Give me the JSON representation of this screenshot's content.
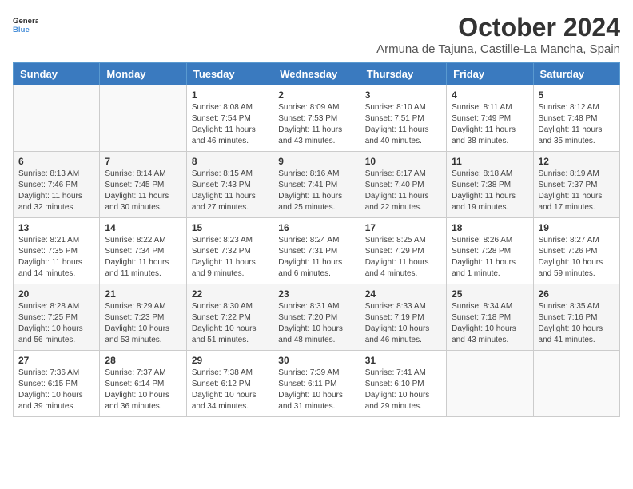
{
  "logo": {
    "line1": "General",
    "line2": "Blue"
  },
  "title": "October 2024",
  "location": "Armuna de Tajuna, Castille-La Mancha, Spain",
  "headers": [
    "Sunday",
    "Monday",
    "Tuesday",
    "Wednesday",
    "Thursday",
    "Friday",
    "Saturday"
  ],
  "weeks": [
    [
      {
        "day": "",
        "info": ""
      },
      {
        "day": "",
        "info": ""
      },
      {
        "day": "1",
        "info": "Sunrise: 8:08 AM\nSunset: 7:54 PM\nDaylight: 11 hours\nand 46 minutes."
      },
      {
        "day": "2",
        "info": "Sunrise: 8:09 AM\nSunset: 7:53 PM\nDaylight: 11 hours\nand 43 minutes."
      },
      {
        "day": "3",
        "info": "Sunrise: 8:10 AM\nSunset: 7:51 PM\nDaylight: 11 hours\nand 40 minutes."
      },
      {
        "day": "4",
        "info": "Sunrise: 8:11 AM\nSunset: 7:49 PM\nDaylight: 11 hours\nand 38 minutes."
      },
      {
        "day": "5",
        "info": "Sunrise: 8:12 AM\nSunset: 7:48 PM\nDaylight: 11 hours\nand 35 minutes."
      }
    ],
    [
      {
        "day": "6",
        "info": "Sunrise: 8:13 AM\nSunset: 7:46 PM\nDaylight: 11 hours\nand 32 minutes."
      },
      {
        "day": "7",
        "info": "Sunrise: 8:14 AM\nSunset: 7:45 PM\nDaylight: 11 hours\nand 30 minutes."
      },
      {
        "day": "8",
        "info": "Sunrise: 8:15 AM\nSunset: 7:43 PM\nDaylight: 11 hours\nand 27 minutes."
      },
      {
        "day": "9",
        "info": "Sunrise: 8:16 AM\nSunset: 7:41 PM\nDaylight: 11 hours\nand 25 minutes."
      },
      {
        "day": "10",
        "info": "Sunrise: 8:17 AM\nSunset: 7:40 PM\nDaylight: 11 hours\nand 22 minutes."
      },
      {
        "day": "11",
        "info": "Sunrise: 8:18 AM\nSunset: 7:38 PM\nDaylight: 11 hours\nand 19 minutes."
      },
      {
        "day": "12",
        "info": "Sunrise: 8:19 AM\nSunset: 7:37 PM\nDaylight: 11 hours\nand 17 minutes."
      }
    ],
    [
      {
        "day": "13",
        "info": "Sunrise: 8:21 AM\nSunset: 7:35 PM\nDaylight: 11 hours\nand 14 minutes."
      },
      {
        "day": "14",
        "info": "Sunrise: 8:22 AM\nSunset: 7:34 PM\nDaylight: 11 hours\nand 11 minutes."
      },
      {
        "day": "15",
        "info": "Sunrise: 8:23 AM\nSunset: 7:32 PM\nDaylight: 11 hours\nand 9 minutes."
      },
      {
        "day": "16",
        "info": "Sunrise: 8:24 AM\nSunset: 7:31 PM\nDaylight: 11 hours\nand 6 minutes."
      },
      {
        "day": "17",
        "info": "Sunrise: 8:25 AM\nSunset: 7:29 PM\nDaylight: 11 hours\nand 4 minutes."
      },
      {
        "day": "18",
        "info": "Sunrise: 8:26 AM\nSunset: 7:28 PM\nDaylight: 11 hours\nand 1 minute."
      },
      {
        "day": "19",
        "info": "Sunrise: 8:27 AM\nSunset: 7:26 PM\nDaylight: 10 hours\nand 59 minutes."
      }
    ],
    [
      {
        "day": "20",
        "info": "Sunrise: 8:28 AM\nSunset: 7:25 PM\nDaylight: 10 hours\nand 56 minutes."
      },
      {
        "day": "21",
        "info": "Sunrise: 8:29 AM\nSunset: 7:23 PM\nDaylight: 10 hours\nand 53 minutes."
      },
      {
        "day": "22",
        "info": "Sunrise: 8:30 AM\nSunset: 7:22 PM\nDaylight: 10 hours\nand 51 minutes."
      },
      {
        "day": "23",
        "info": "Sunrise: 8:31 AM\nSunset: 7:20 PM\nDaylight: 10 hours\nand 48 minutes."
      },
      {
        "day": "24",
        "info": "Sunrise: 8:33 AM\nSunset: 7:19 PM\nDaylight: 10 hours\nand 46 minutes."
      },
      {
        "day": "25",
        "info": "Sunrise: 8:34 AM\nSunset: 7:18 PM\nDaylight: 10 hours\nand 43 minutes."
      },
      {
        "day": "26",
        "info": "Sunrise: 8:35 AM\nSunset: 7:16 PM\nDaylight: 10 hours\nand 41 minutes."
      }
    ],
    [
      {
        "day": "27",
        "info": "Sunrise: 7:36 AM\nSunset: 6:15 PM\nDaylight: 10 hours\nand 39 minutes."
      },
      {
        "day": "28",
        "info": "Sunrise: 7:37 AM\nSunset: 6:14 PM\nDaylight: 10 hours\nand 36 minutes."
      },
      {
        "day": "29",
        "info": "Sunrise: 7:38 AM\nSunset: 6:12 PM\nDaylight: 10 hours\nand 34 minutes."
      },
      {
        "day": "30",
        "info": "Sunrise: 7:39 AM\nSunset: 6:11 PM\nDaylight: 10 hours\nand 31 minutes."
      },
      {
        "day": "31",
        "info": "Sunrise: 7:41 AM\nSunset: 6:10 PM\nDaylight: 10 hours\nand 29 minutes."
      },
      {
        "day": "",
        "info": ""
      },
      {
        "day": "",
        "info": ""
      }
    ]
  ]
}
